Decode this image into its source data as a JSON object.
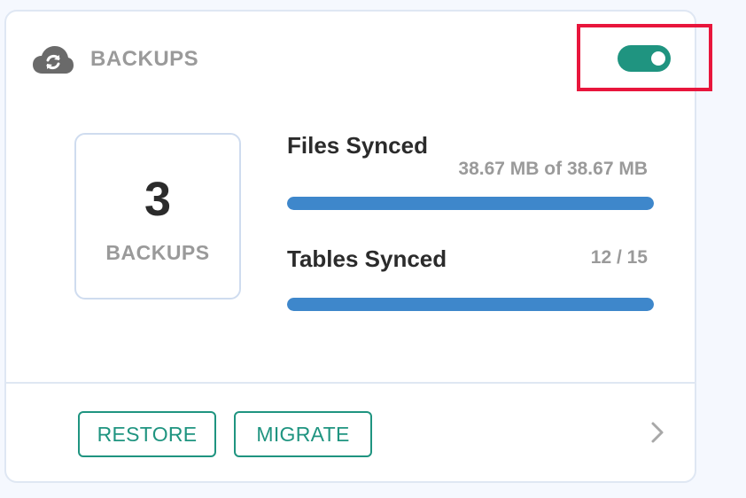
{
  "header": {
    "title": "BACKUPS",
    "icon": "cloud-sync-icon",
    "toggle_on": true
  },
  "summary": {
    "count": "3",
    "label": "BACKUPS"
  },
  "stats": [
    {
      "label": "Files Synced",
      "value": "38.67 MB of 38.67 MB",
      "progress": 1.0
    },
    {
      "label": "Tables Synced",
      "value": "12 / 15",
      "progress": 1.0
    }
  ],
  "footer": {
    "restore_label": "RESTORE",
    "migrate_label": "MIGRATE",
    "next_icon": "chevron-right-icon"
  },
  "colors": {
    "accent": "#1f9480",
    "progress": "#3e87cb",
    "highlight": "#e8163c"
  }
}
